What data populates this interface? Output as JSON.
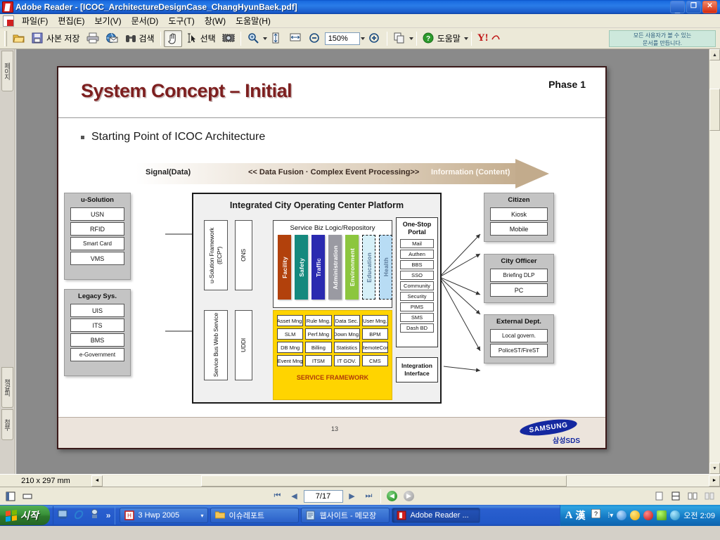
{
  "window": {
    "title": "Adobe Reader - [ICOC_ArchitectureDesignCase_ChangHyunBaek.pdf]",
    "minimize": "_",
    "restore": "❐",
    "close": "✕"
  },
  "menubar": {
    "items": [
      {
        "label": "파일(F)"
      },
      {
        "label": "편집(E)"
      },
      {
        "label": "보기(V)"
      },
      {
        "label": "문서(D)"
      },
      {
        "label": "도구(T)"
      },
      {
        "label": "창(W)"
      },
      {
        "label": "도움말(H)"
      }
    ]
  },
  "toolbar": {
    "open_label": "",
    "save_copy_label": "사본 저장",
    "print_label": "",
    "email_label": "",
    "search_label": "검색",
    "hand_label": "",
    "select_label": "선택",
    "snapshot_label": "",
    "zoom_in_label": "",
    "zoom_value": "150%",
    "zoom_out_label": "",
    "help_label": "도움말",
    "yahoo_label": "Y!",
    "promo_line1": "모든 사용자가 볼 수 있는",
    "promo_line2": "문서를 만듭니다."
  },
  "navtabs": [
    {
      "label": "페이지"
    },
    {
      "label": "책갈피"
    },
    {
      "label": "첨부"
    }
  ],
  "slide": {
    "title": "System Concept – Initial",
    "phase": "Phase 1",
    "bullet": "Starting Point of ICOC Architecture",
    "band": {
      "left": "Signal(Data)",
      "center": "<< Data Fusion · Complex Event Processing>>",
      "right": "Information (Content)"
    },
    "page_number": "13",
    "logo": "SAMSUNG",
    "logo_sub": "삼성SDS"
  },
  "diagram": {
    "left_groups": [
      {
        "title": "u-Solution",
        "items": [
          "USN",
          "RFID",
          "Smart Card",
          "VMS"
        ]
      },
      {
        "title": "Legacy Sys.",
        "items": [
          "UIS",
          "ITS",
          "BMS",
          "e-Government"
        ]
      }
    ],
    "connectors": [
      {
        "label": "u-Solution Framework (ECP*)"
      },
      {
        "label": "ONS"
      },
      {
        "label": "Service Bus Web Service"
      },
      {
        "label": "UDDI"
      }
    ],
    "platform": {
      "title": "Integrated City Operating Center Platform",
      "biz_logic_title": "Service Biz Logic/Repository",
      "bars": [
        {
          "label": "Facility",
          "color": "#b2410c",
          "style": "solid"
        },
        {
          "label": "Safety",
          "color": "#15897e",
          "style": "solid"
        },
        {
          "label": "Traffic",
          "color": "#2a2ab0",
          "style": "solid"
        },
        {
          "label": "Administration",
          "color": "#9a9aa2",
          "style": "solid"
        },
        {
          "label": "Environment",
          "color": "#8cc63e",
          "style": "solid"
        },
        {
          "label": "Education",
          "color": "#d6f0f8",
          "style": "dashed"
        },
        {
          "label": "Health",
          "color": "#b8dcf4",
          "style": "dashed"
        }
      ],
      "framework_label": "SERVICE FRAMEWORK",
      "framework_cells": [
        "Asset Mng.",
        "Rule Mng.",
        "Data Sec.",
        "User Mng.",
        "SLM",
        "Perf.Mng",
        "Down Mng.",
        "BPM",
        "DB Mng",
        "Billing",
        "Statistics",
        "RemoteCon",
        "Event Mng",
        "ITSM",
        "IT GOV.",
        "CMS"
      ],
      "framework_bg": "#ffd400"
    },
    "portal": {
      "title": "One-Stop Portal",
      "items": [
        "Mail",
        "Authen",
        "BBS",
        "SSO",
        "Community",
        "Security",
        "PIMS",
        "SMS",
        "Dash BD"
      ]
    },
    "integration": "Integration Interface",
    "right_groups": [
      {
        "title": "Citizen",
        "items": [
          "Kiosk",
          "Mobile"
        ]
      },
      {
        "title": "City Officer",
        "items": [
          "Briefing DLP",
          "PC"
        ]
      },
      {
        "title": "External Dept.",
        "items": [
          "Local govern.",
          "PoliceST/FireST"
        ]
      }
    ]
  },
  "statusbar": {
    "page_size": "210 x 297 mm"
  },
  "pagebar": {
    "first": "⏮",
    "prev": "◀",
    "page_value": "7/17",
    "next": "▶",
    "last": "⏭",
    "back": "◀",
    "forward": "▶"
  },
  "taskbar": {
    "start": "시작",
    "tasks": [
      {
        "label": "3 Hwp 2005",
        "icon": "hwp-icon"
      },
      {
        "label": "이슈레포트",
        "icon": "folder-icon"
      },
      {
        "label": "웹사이트 - 메모장",
        "icon": "notepad-icon"
      },
      {
        "label": "Adobe Reader ...",
        "icon": "acrobat-icon"
      }
    ],
    "ime": [
      "A",
      "漢"
    ],
    "clock": "오전 2:09"
  }
}
